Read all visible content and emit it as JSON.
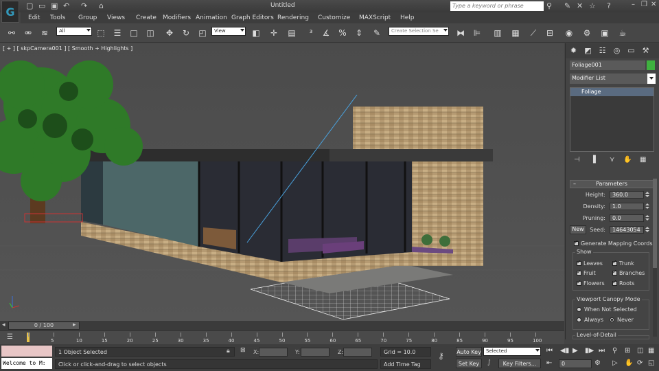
{
  "app": {
    "title": "Untitled",
    "logo": "3ds-max-logo",
    "search_placeholder": "Type a keyword or phrase"
  },
  "menu": [
    "Edit",
    "Tools",
    "Group",
    "Views",
    "Create",
    "Modifiers",
    "Animation",
    "Graph Editors",
    "Rendering",
    "Customize",
    "MAXScript",
    "Help"
  ],
  "toolbar": {
    "selection_filter": "All",
    "reference_coord": "View",
    "named_selection_placeholder": "Create Selection Se"
  },
  "viewport": {
    "label": "[ + ] [ skpCamera001 ] [ Smooth + Highlights ]"
  },
  "command_panel": {
    "object_name": "Foliage001",
    "object_color": "#3fb23f",
    "modifier_list": "Modifier List",
    "stack": [
      "Foliage"
    ],
    "parameters": {
      "title": "Parameters",
      "height_label": "Height:",
      "height": "360.0",
      "density_label": "Density:",
      "density": "1.0",
      "pruning_label": "Pruning:",
      "pruning": "0.0",
      "new_button": "New",
      "seed_label": "Seed:",
      "seed": "14643054",
      "gen_mapping": "Generate Mapping Coords",
      "show": {
        "title": "Show",
        "leaves": "Leaves",
        "trunk": "Trunk",
        "fruit": "Fruit",
        "branches": "Branches",
        "flowers": "Flowers",
        "roots": "Roots"
      },
      "canopy": {
        "title": "Viewport Canopy Mode",
        "when_not_selected": "When Not Selected",
        "always": "Always",
        "never": "Never"
      },
      "lod_title": "Level-of-Detail"
    }
  },
  "timeline": {
    "slider": "0 / 100",
    "ticks": [
      "5",
      "10",
      "15",
      "20",
      "25",
      "30",
      "35",
      "40",
      "45",
      "50",
      "55",
      "60",
      "65",
      "70",
      "75",
      "80",
      "85",
      "90",
      "95",
      "100"
    ]
  },
  "status": {
    "welcome": "Welcome to M:",
    "selection": "1 Object Selected",
    "prompt": "Click or click-and-drag to select objects",
    "x_label": "X:",
    "y_label": "Y:",
    "z_label": "Z:",
    "grid": "Grid = 10.0",
    "add_time_tag": "Add Time Tag",
    "auto_key": "Auto Key",
    "set_key": "Set Key",
    "key_mode": "Selected",
    "key_filters": "Key Filters...",
    "frame": "0"
  }
}
